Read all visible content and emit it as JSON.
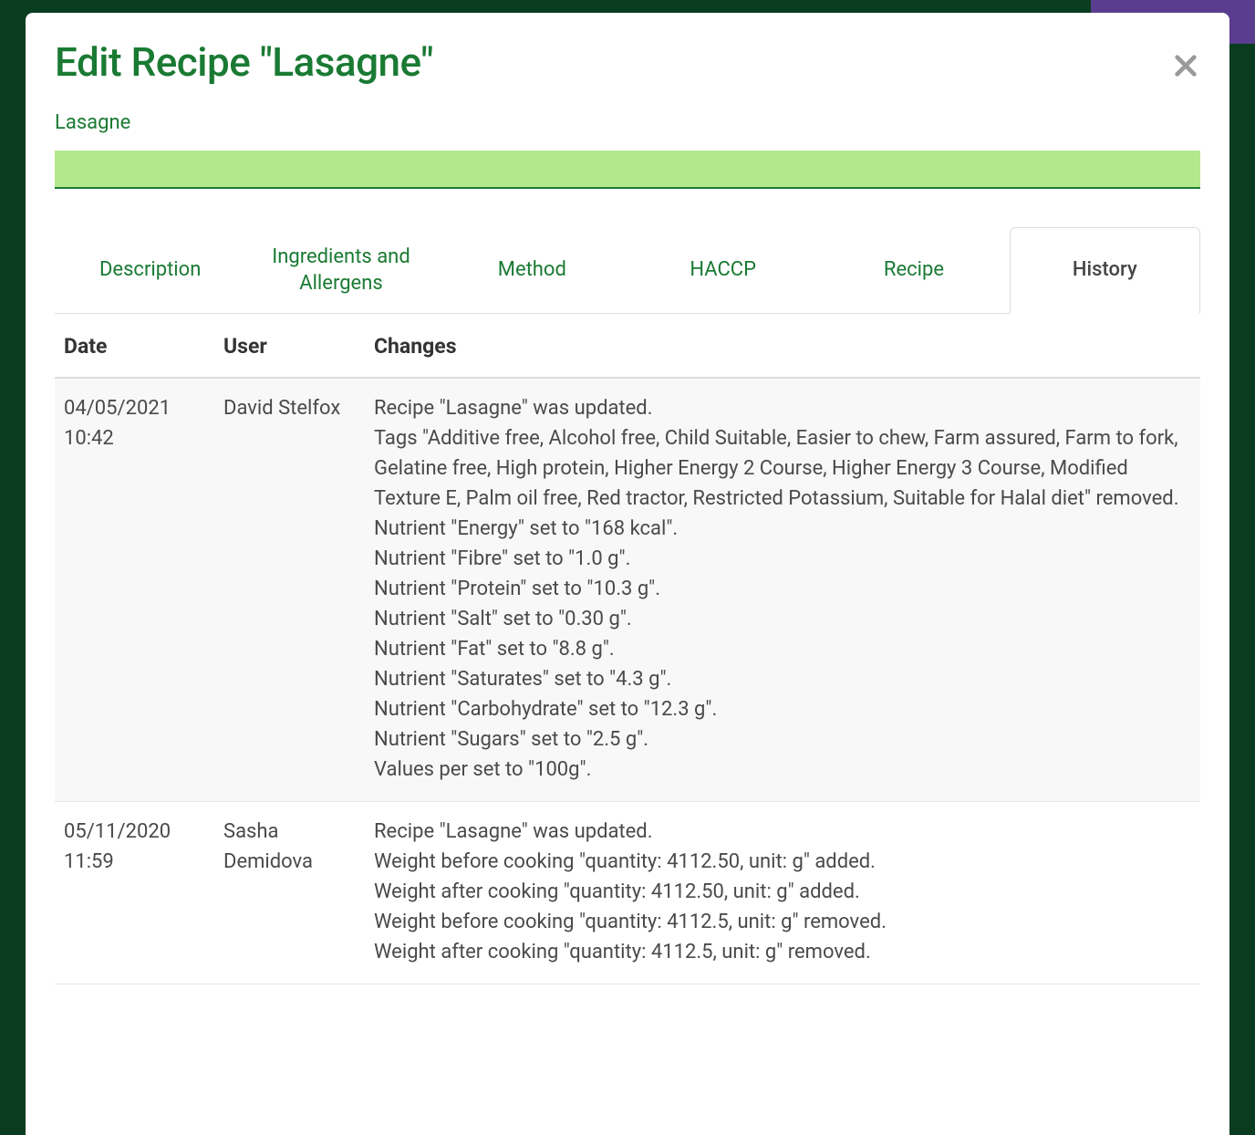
{
  "modal": {
    "title": "Edit Recipe \"Lasagne\"",
    "breadcrumb": "Lasagne"
  },
  "tabs": [
    {
      "label": "Description",
      "active": false
    },
    {
      "label": "Ingredients and Allergens",
      "active": false
    },
    {
      "label": "Method",
      "active": false
    },
    {
      "label": "HACCP",
      "active": false
    },
    {
      "label": "Recipe",
      "active": false
    },
    {
      "label": "History",
      "active": true
    }
  ],
  "table": {
    "headers": {
      "date": "Date",
      "user": "User",
      "changes": "Changes"
    },
    "rows": [
      {
        "date": "04/05/2021 10:42",
        "user": "David Stelfox",
        "changes": [
          "Recipe \"Lasagne\" was updated.",
          "Tags \"Additive free, Alcohol free, Child Suitable, Easier to chew, Farm assured, Farm to fork, Gelatine free, High protein, Higher Energy 2 Course, Higher Energy 3 Course, Modified Texture E, Palm oil free, Red tractor, Restricted Potassium, Suitable for Halal diet\" removed.",
          "Nutrient \"Energy\" set to \"168 kcal\".",
          "Nutrient \"Fibre\" set to \"1.0 g\".",
          "Nutrient \"Protein\" set to \"10.3 g\".",
          "Nutrient \"Salt\" set to \"0.30 g\".",
          "Nutrient \"Fat\" set to \"8.8 g\".",
          "Nutrient \"Saturates\" set to \"4.3 g\".",
          "Nutrient \"Carbohydrate\" set to \"12.3 g\".",
          "Nutrient \"Sugars\" set to \"2.5 g\".",
          "Values per set to \"100g\"."
        ]
      },
      {
        "date": "05/11/2020 11:59",
        "user": "Sasha Demidova",
        "changes": [
          "Recipe \"Lasagne\" was updated.",
          "Weight before cooking \"quantity: 4112.50, unit: g\" added.",
          "Weight after cooking \"quantity: 4112.50, unit: g\" added.",
          "Weight before cooking \"quantity: 4112.5, unit: g\" removed.",
          "Weight after cooking \"quantity: 4112.5, unit: g\" removed."
        ]
      }
    ]
  }
}
